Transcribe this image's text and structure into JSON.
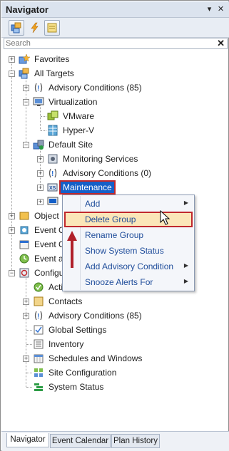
{
  "window": {
    "title": "Navigator",
    "pin_glyph": "▾",
    "close_glyph": "✕"
  },
  "toolbar": {
    "buttons": [
      "targets-icon",
      "lightning-icon",
      "notes-icon"
    ]
  },
  "search": {
    "placeholder": "Search",
    "value": "",
    "clear_glyph": "✕"
  },
  "tree": {
    "favorites": "Favorites",
    "all_targets": "All Targets",
    "advisory_85": "Advisory Conditions (85)",
    "virtualization": "Virtualization",
    "vmware": "VMware",
    "hyperv": "Hyper-V",
    "default_site": "Default Site",
    "monitoring_services": "Monitoring Services",
    "advisory_0": "Advisory Conditions (0)",
    "maintenance": "Maintenance",
    "object": "Object",
    "event_c1": "Event C",
    "event_c2": "Event C",
    "event_a": "Event a",
    "configu": "Configu",
    "acti": "Acti",
    "contacts": "Contacts",
    "advisory_85b": "Advisory Conditions (85)",
    "global_settings": "Global Settings",
    "inventory": "Inventory",
    "schedules": "Schedules and Windows",
    "site_configuration": "Site Configuration",
    "system_status": "System Status"
  },
  "context_menu": {
    "items": [
      {
        "label": "Add",
        "submenu": true
      },
      {
        "label": "Delete Group",
        "submenu": false
      },
      {
        "label": "Rename Group",
        "submenu": false
      },
      {
        "label": "Show System Status",
        "submenu": false
      },
      {
        "label": "Add Advisory Condition",
        "submenu": true
      },
      {
        "label": "Snooze Alerts For",
        "submenu": true
      }
    ],
    "submenu_glyph": "▶"
  },
  "tabs": {
    "navigator": "Navigator",
    "event_calendar": "Event Calendar",
    "plan_history": "Plan History"
  },
  "colors": {
    "selection": "#1560c8",
    "highlight_border": "#c0282d",
    "menu_text": "#1e4c9a"
  }
}
